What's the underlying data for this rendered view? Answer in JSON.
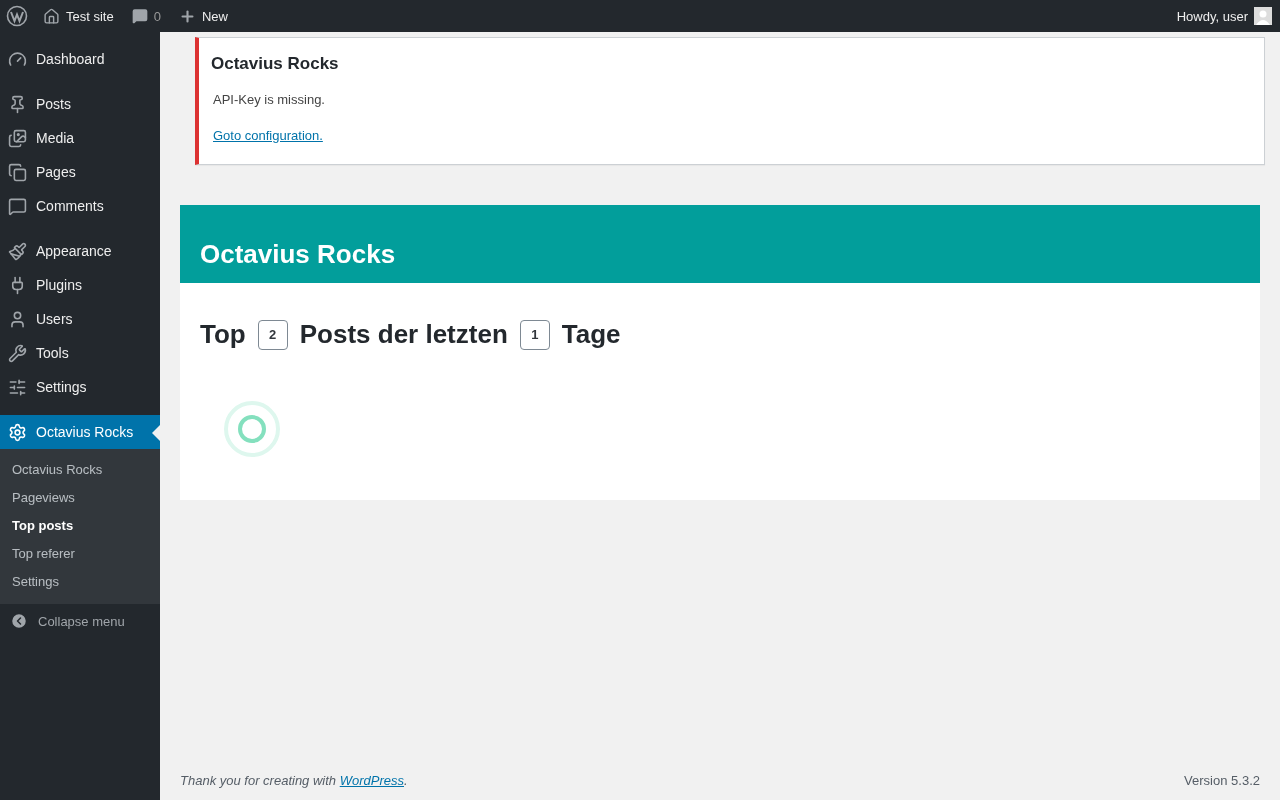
{
  "admin_bar": {
    "site": "Test site",
    "comments_count": "0",
    "new": "New",
    "greeting": "Howdy, user"
  },
  "menu": {
    "groups": [
      [
        {
          "label": "Dashboard",
          "selected": false
        }
      ],
      [
        {
          "label": "Posts",
          "selected": false
        },
        {
          "label": "Media",
          "selected": false
        },
        {
          "label": "Pages",
          "selected": false
        },
        {
          "label": "Comments",
          "selected": false
        }
      ],
      [
        {
          "label": "Appearance",
          "selected": false
        },
        {
          "label": "Plugins",
          "selected": false
        },
        {
          "label": "Users",
          "selected": false
        },
        {
          "label": "Tools",
          "selected": false
        },
        {
          "label": "Settings",
          "selected": false
        }
      ],
      [
        {
          "label": "Octavius Rocks",
          "selected": true
        }
      ]
    ],
    "submenu": [
      {
        "label": "Octavius Rocks",
        "selected": false
      },
      {
        "label": "Pageviews",
        "selected": false
      },
      {
        "label": "Top posts",
        "selected": true
      },
      {
        "label": "Top referer",
        "selected": false
      },
      {
        "label": "Settings",
        "selected": false
      }
    ],
    "collapse": "Collapse menu"
  },
  "notice": {
    "title": "Octavius Rocks",
    "message": "API-Key is missing.",
    "link": "Goto configuration."
  },
  "panel": {
    "title": "Octavius Rocks",
    "heading": {
      "before": "Top",
      "count": "2",
      "middle": "Posts der letzten",
      "days": "1",
      "after": "Tage"
    }
  },
  "footer": {
    "thanks": "Thank you for creating with",
    "link": "WordPress",
    "after": ".",
    "version": "Version 5.3.2"
  }
}
